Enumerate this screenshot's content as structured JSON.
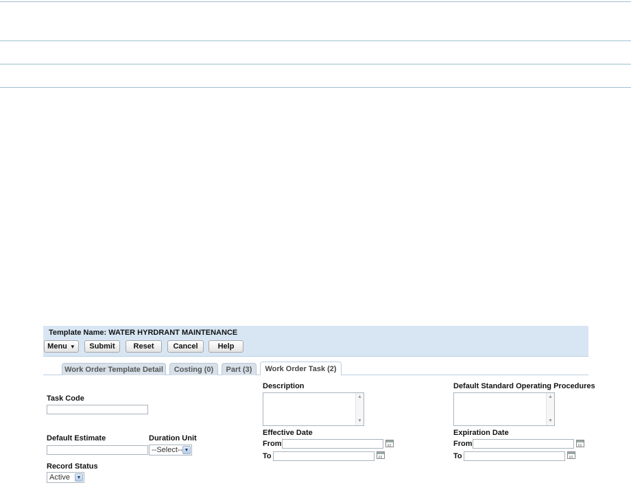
{
  "header": {
    "template_label": "Template Name:",
    "template_name": "WATER HYRDRANT MAINTENANCE"
  },
  "toolbar": {
    "menu_label": "Menu",
    "submit_label": "Submit",
    "reset_label": "Reset",
    "cancel_label": "Cancel",
    "help_label": "Help"
  },
  "tabs": [
    {
      "label": "Work Order Template Detail",
      "active": false
    },
    {
      "label": "Costing (0)",
      "active": false
    },
    {
      "label": "Part (3)",
      "active": false
    },
    {
      "label": "Work Order Task (2)",
      "active": true
    }
  ],
  "form": {
    "task_code_label": "Task Code",
    "task_code_value": "",
    "description_label": "Description",
    "description_value": "",
    "sop_label": "Default Standard Operating Procedures",
    "sop_value": "",
    "default_estimate_label": "Default Estimate",
    "default_estimate_value": "",
    "duration_unit_label": "Duration Unit",
    "duration_unit_value": "--Select--",
    "effective_date_label": "Effective Date",
    "expiration_date_label": "Expiration Date",
    "from_label": "From",
    "to_label": "To",
    "record_status_label": "Record Status",
    "record_status_value": "Active"
  },
  "colors": {
    "header_panel": "#d8e6f4",
    "tab_inactive": "#d8e1ea",
    "rule": "#9fc0d0"
  }
}
